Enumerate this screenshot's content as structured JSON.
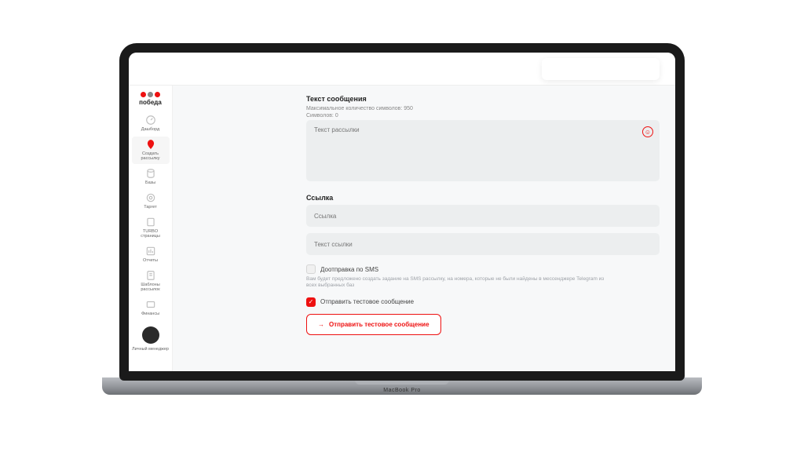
{
  "brand": "победа",
  "laptop_model": "MacBook Pro",
  "sidebar": {
    "items": [
      {
        "label": "Дашборд"
      },
      {
        "label": "Создать рассылку"
      },
      {
        "label": "Базы"
      },
      {
        "label": "Таргет"
      },
      {
        "label": "TURBO страницы"
      },
      {
        "label": "Отчеты"
      },
      {
        "label": "Шаблоны рассылок"
      },
      {
        "label": "Финансы"
      }
    ],
    "manager_label": "Личный менеджер"
  },
  "message": {
    "title": "Текст сообщения",
    "max_hint": "Максимальное количество символов: 950",
    "count_hint": "Символов: 0",
    "placeholder": "Текст рассылки"
  },
  "link": {
    "title": "Ссылка",
    "url_placeholder": "Ссылка",
    "text_placeholder": "Текст ссылки"
  },
  "sms_followup": {
    "label": "Доотправка по SMS",
    "description": "Вам будет предложено создать задание на SMS рассылку, на номера, которые не были найдены в мессенджере Telegram из всех выбранных баз"
  },
  "test": {
    "checkbox_label": "Отправить тестовое сообщение",
    "button_label": "Отправить тестовое сообщение"
  }
}
